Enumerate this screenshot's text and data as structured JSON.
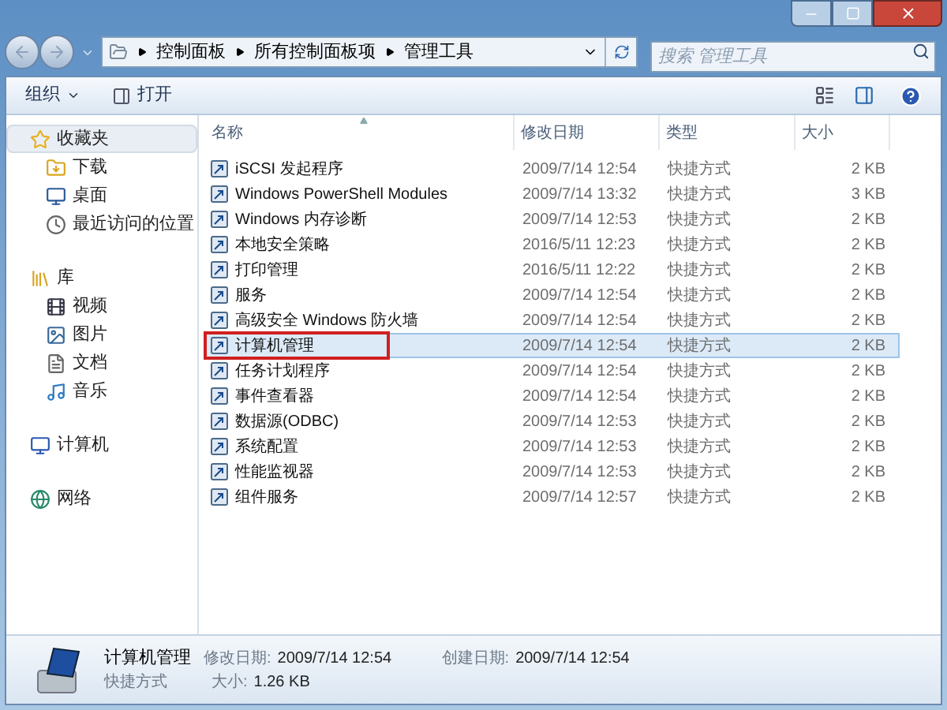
{
  "address_bar": {
    "path": [
      "控制面板",
      "所有控制面板项",
      "管理工具"
    ]
  },
  "search": {
    "placeholder": "搜索 管理工具"
  },
  "toolbar": {
    "organize": "组织",
    "open": "打开"
  },
  "sidebar": {
    "groups": [
      {
        "label": "收藏夹",
        "kind": "star",
        "selected": true,
        "children": [
          {
            "label": "下载",
            "kind": "download",
            "selected": false
          },
          {
            "label": "桌面",
            "kind": "desktop",
            "selected": false
          },
          {
            "label": "最近访问的位置",
            "kind": "recent",
            "selected": false
          }
        ]
      },
      {
        "label": "库",
        "kind": "library",
        "selected": false,
        "children": [
          {
            "label": "视频",
            "kind": "video",
            "selected": false
          },
          {
            "label": "图片",
            "kind": "picture",
            "selected": false
          },
          {
            "label": "文档",
            "kind": "document",
            "selected": false
          },
          {
            "label": "音乐",
            "kind": "music",
            "selected": false
          }
        ]
      },
      {
        "label": "计算机",
        "kind": "computer",
        "selected": false
      },
      {
        "label": "网络",
        "kind": "network",
        "selected": false
      }
    ]
  },
  "table": {
    "columns": [
      "名称",
      "修改日期",
      "类型",
      "大小"
    ],
    "rows": [
      {
        "name": "iSCSI 发起程序",
        "date": "2009/7/14 12:54",
        "type": "快捷方式",
        "size": "2 KB",
        "selected": false,
        "highlighted": false
      },
      {
        "name": "Windows PowerShell Modules",
        "date": "2009/7/14 13:32",
        "type": "快捷方式",
        "size": "3 KB",
        "selected": false,
        "highlighted": false
      },
      {
        "name": "Windows 内存诊断",
        "date": "2009/7/14 12:53",
        "type": "快捷方式",
        "size": "2 KB",
        "selected": false,
        "highlighted": false
      },
      {
        "name": "本地安全策略",
        "date": "2016/5/11 12:23",
        "type": "快捷方式",
        "size": "2 KB",
        "selected": false,
        "highlighted": false
      },
      {
        "name": "打印管理",
        "date": "2016/5/11 12:22",
        "type": "快捷方式",
        "size": "2 KB",
        "selected": false,
        "highlighted": false
      },
      {
        "name": "服务",
        "date": "2009/7/14 12:54",
        "type": "快捷方式",
        "size": "2 KB",
        "selected": false,
        "highlighted": false
      },
      {
        "name": "高级安全 Windows 防火墙",
        "date": "2009/7/14 12:54",
        "type": "快捷方式",
        "size": "2 KB",
        "selected": false,
        "highlighted": false
      },
      {
        "name": "计算机管理",
        "date": "2009/7/14 12:54",
        "type": "快捷方式",
        "size": "2 KB",
        "selected": true,
        "highlighted": true
      },
      {
        "name": "任务计划程序",
        "date": "2009/7/14 12:54",
        "type": "快捷方式",
        "size": "2 KB",
        "selected": false,
        "highlighted": false
      },
      {
        "name": "事件查看器",
        "date": "2009/7/14 12:54",
        "type": "快捷方式",
        "size": "2 KB",
        "selected": false,
        "highlighted": false
      },
      {
        "name": "数据源(ODBC)",
        "date": "2009/7/14 12:53",
        "type": "快捷方式",
        "size": "2 KB",
        "selected": false,
        "highlighted": false
      },
      {
        "name": "系统配置",
        "date": "2009/7/14 12:53",
        "type": "快捷方式",
        "size": "2 KB",
        "selected": false,
        "highlighted": false
      },
      {
        "name": "性能监视器",
        "date": "2009/7/14 12:53",
        "type": "快捷方式",
        "size": "2 KB",
        "selected": false,
        "highlighted": false
      },
      {
        "name": "组件服务",
        "date": "2009/7/14 12:57",
        "type": "快捷方式",
        "size": "2 KB",
        "selected": false,
        "highlighted": false
      }
    ]
  },
  "details": {
    "name": "计算机管理",
    "type": "快捷方式",
    "modified_label": "修改日期:",
    "modified": "2009/7/14 12:54",
    "created_label": "创建日期:",
    "created": "2009/7/14 12:54",
    "size_label": "大小:",
    "size": "1.26 KB"
  }
}
